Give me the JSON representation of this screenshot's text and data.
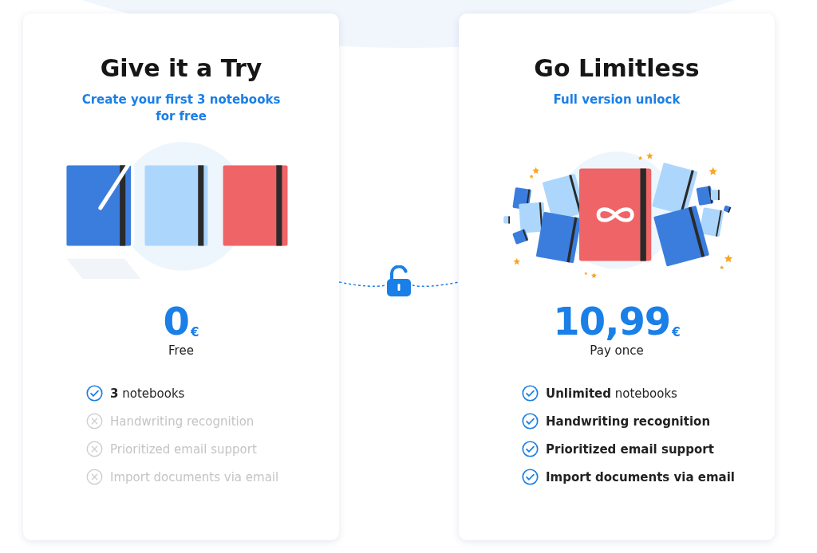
{
  "plans": [
    {
      "title": "Give it a Try",
      "subtitle": "Create your first 3 notebooks for free",
      "kind": "three-notebooks",
      "price": "0",
      "currency": "€",
      "price_note": "Free",
      "features": [
        {
          "text": "**3** notebooks",
          "included": true,
          "emphasis": false
        },
        {
          "text": "Handwriting recognition",
          "included": false,
          "emphasis": false
        },
        {
          "text": "Prioritized email support",
          "included": false,
          "emphasis": false
        },
        {
          "text": "Import documents via email",
          "included": false,
          "emphasis": false
        }
      ]
    },
    {
      "title": "Go Limitless",
      "subtitle": "Full version unlock",
      "kind": "unlimited-notebooks",
      "price": "10,99",
      "currency": "€",
      "price_note": "Pay once",
      "features": [
        {
          "text": "**Unlimited** notebooks",
          "included": true,
          "emphasis": false
        },
        {
          "text": "Handwriting recognition",
          "included": true,
          "emphasis": true
        },
        {
          "text": "Prioritized email support",
          "included": true,
          "emphasis": true
        },
        {
          "text": "Import documents via email",
          "included": true,
          "emphasis": true
        }
      ]
    }
  ]
}
